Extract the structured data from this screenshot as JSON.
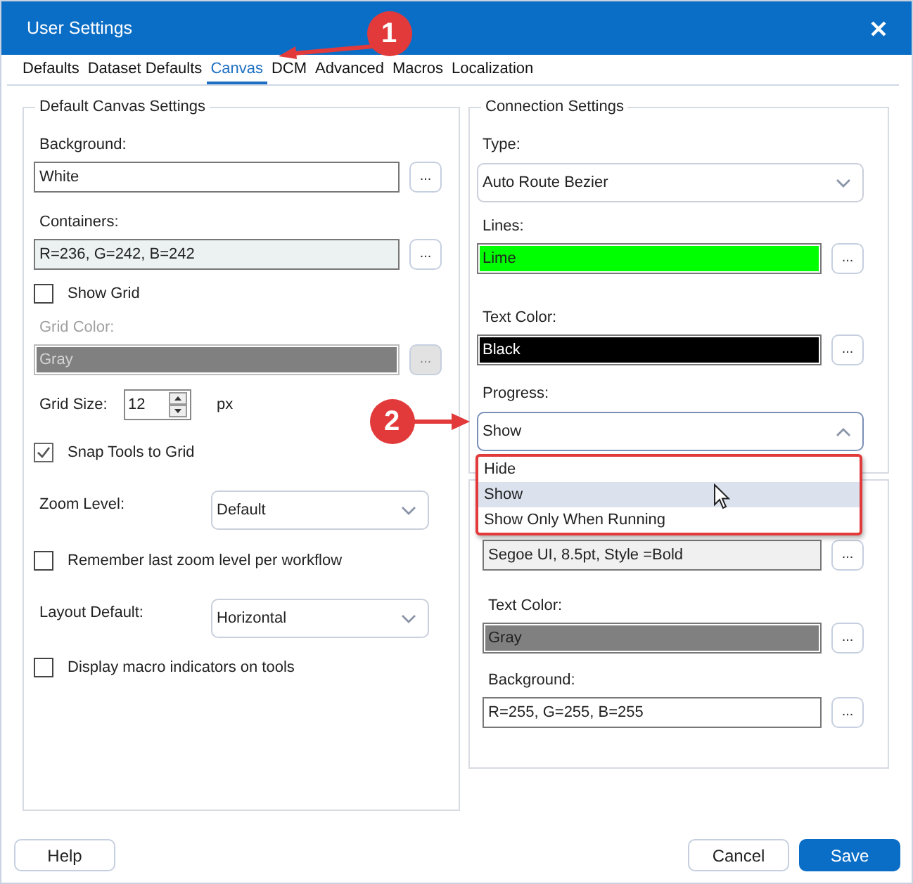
{
  "window": {
    "title": "User Settings"
  },
  "tabs": [
    {
      "label": "Defaults",
      "selected": false
    },
    {
      "label": "Dataset Defaults",
      "selected": false
    },
    {
      "label": "Canvas",
      "selected": true
    },
    {
      "label": "DCM",
      "selected": false
    },
    {
      "label": "Advanced",
      "selected": false
    },
    {
      "label": "Macros",
      "selected": false
    },
    {
      "label": "Localization",
      "selected": false
    }
  ],
  "left_group": {
    "title": "Default Canvas Settings",
    "rows": [
      {
        "kind": "color",
        "label": "Background:",
        "value": "White",
        "color": "#ffffff",
        "disabled": false,
        "button": "..."
      },
      {
        "kind": "color",
        "label": "Containers:",
        "value": "R=236, G=242, B=242",
        "color": "#ecf2f2",
        "disabled": false,
        "button": "..."
      },
      {
        "kind": "checkbox",
        "label": "Show Grid",
        "checked": false
      },
      {
        "kind": "color",
        "label": "Grid Color:",
        "value": "Gray",
        "color": "#808080",
        "disabled": true,
        "button": "..."
      },
      {
        "kind": "spinner",
        "label": "Grid Size:",
        "value": "12",
        "unit": "px"
      },
      {
        "kind": "checkbox",
        "label": "Snap Tools to Grid",
        "checked": true
      },
      {
        "kind": "select",
        "label": "Zoom Level:",
        "value": "Default",
        "expanded": false
      },
      {
        "kind": "checkbox",
        "label": "Remember last zoom level per workflow",
        "checked": false
      },
      {
        "kind": "select",
        "label": "Layout Default:",
        "value": "Horizontal",
        "expanded": false
      },
      {
        "kind": "checkbox",
        "label": "Display macro indicators on tools",
        "checked": false
      }
    ]
  },
  "connection_group": {
    "title": "Connection Settings",
    "rows": [
      {
        "kind": "select",
        "label": "Type:",
        "value": "Auto Route Bezier",
        "expanded": false
      },
      {
        "kind": "color",
        "label": "Lines:",
        "value": "Lime",
        "color": "#00ff00",
        "disabled": false,
        "button": "..."
      },
      {
        "kind": "color",
        "label": "Text Color:",
        "value": "Black",
        "color": "#000000",
        "disabled": false,
        "button": "..."
      },
      {
        "kind": "select",
        "label": "Progress:",
        "value": "Show",
        "expanded": true,
        "options": [
          {
            "label": "Hide",
            "selected": false
          },
          {
            "label": "Show",
            "selected": true
          },
          {
            "label": "Show Only When Running",
            "selected": false
          }
        ]
      }
    ]
  },
  "label_group": {
    "rows": [
      {
        "kind": "color",
        "value": "Segoe UI, 8.5pt, Style =Bold",
        "color": "#f0f0f0",
        "disabled": false,
        "button": "..."
      },
      {
        "kind": "color",
        "label": "Text Color:",
        "value": "Gray",
        "color": "#808080",
        "disabled": false,
        "button": "..."
      },
      {
        "kind": "color",
        "label": "Background:",
        "value": "R=255, G=255, B=255",
        "color": "#ffffff",
        "disabled": false,
        "button": "..."
      }
    ]
  },
  "footer_buttons": [
    {
      "label": "Help",
      "kind": "default"
    },
    {
      "label": "Cancel",
      "kind": "default"
    },
    {
      "label": "Save",
      "kind": "primary"
    }
  ],
  "annotations": [
    {
      "number": "1"
    },
    {
      "number": "2"
    }
  ]
}
